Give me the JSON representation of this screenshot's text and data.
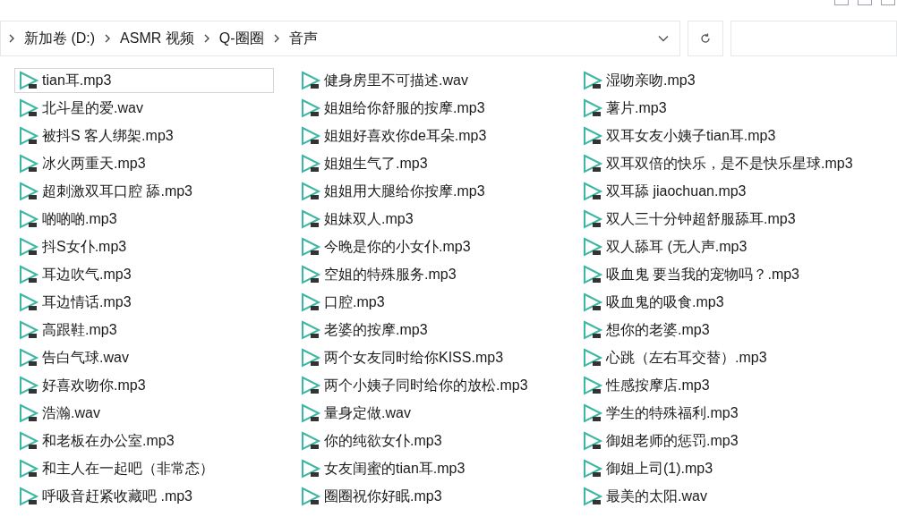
{
  "address_bar": {
    "path": [
      "新加卷 (D:)",
      "ASMR 视频",
      "Q-圈圈",
      "音声"
    ]
  },
  "files": [
    {
      "name": "tian耳.mp3",
      "selected": true
    },
    {
      "name": "北斗星的爱.wav",
      "selected": false
    },
    {
      "name": "被抖S 客人绑架.mp3",
      "selected": false
    },
    {
      "name": "冰火两重天.mp3",
      "selected": false
    },
    {
      "name": "超刺激双耳口腔 舔.mp3",
      "selected": false
    },
    {
      "name": "啲啲啲.mp3",
      "selected": false
    },
    {
      "name": "抖S女仆.mp3",
      "selected": false
    },
    {
      "name": "耳边吹气.mp3",
      "selected": false
    },
    {
      "name": "耳边情话.mp3",
      "selected": false
    },
    {
      "name": "高跟鞋.mp3",
      "selected": false
    },
    {
      "name": "告白气球.wav",
      "selected": false
    },
    {
      "name": "好喜欢吻你.mp3",
      "selected": false
    },
    {
      "name": "浩瀚.wav",
      "selected": false
    },
    {
      "name": "和老板在办公室.mp3",
      "selected": false
    },
    {
      "name": "和主人在一起吧（非常态）",
      "selected": false
    },
    {
      "name": "呼吸音赶紧收藏吧 .mp3",
      "selected": false
    },
    {
      "name": "健身房里不可描述.wav",
      "selected": false
    },
    {
      "name": "姐姐给你舒服的按摩.mp3",
      "selected": false
    },
    {
      "name": "姐姐好喜欢你de耳朵.mp3",
      "selected": false
    },
    {
      "name": "姐姐生气了.mp3",
      "selected": false
    },
    {
      "name": "姐姐用大腿给你按摩.mp3",
      "selected": false
    },
    {
      "name": "姐妹双人.mp3",
      "selected": false
    },
    {
      "name": "今晚是你的小女仆.mp3",
      "selected": false
    },
    {
      "name": "空姐的特殊服务.mp3",
      "selected": false
    },
    {
      "name": "口腔.mp3",
      "selected": false
    },
    {
      "name": "老婆的按摩.mp3",
      "selected": false
    },
    {
      "name": "两个女友同时给你KISS.mp3",
      "selected": false
    },
    {
      "name": "两个小姨子同时给你的放松.mp3",
      "selected": false
    },
    {
      "name": "量身定做.wav",
      "selected": false
    },
    {
      "name": "你的纯欲女仆.mp3",
      "selected": false
    },
    {
      "name": "女友闺蜜的tian耳.mp3",
      "selected": false
    },
    {
      "name": "圈圈祝你好眠.mp3",
      "selected": false
    },
    {
      "name": "湿吻亲吻.mp3",
      "selected": false
    },
    {
      "name": "薯片.mp3",
      "selected": false
    },
    {
      "name": "双耳女友小姨子tian耳.mp3",
      "selected": false
    },
    {
      "name": "双耳双倍的快乐，是不是快乐星球.mp3",
      "selected": false
    },
    {
      "name": "双耳舔 jiaochuan.mp3",
      "selected": false
    },
    {
      "name": "双人三十分钟超舒服舔耳.mp3",
      "selected": false
    },
    {
      "name": "双人舔耳 (无人声.mp3",
      "selected": false
    },
    {
      "name": "吸血鬼 要当我的宠物吗？.mp3",
      "selected": false
    },
    {
      "name": "吸血鬼的吸食.mp3",
      "selected": false
    },
    {
      "name": "想你的老婆.mp3",
      "selected": false
    },
    {
      "name": "心跳（左右耳交替）.mp3",
      "selected": false
    },
    {
      "name": "性感按摩店.mp3",
      "selected": false
    },
    {
      "name": "学生的特殊福利.mp3",
      "selected": false
    },
    {
      "name": "御姐老师的惩罚.mp3",
      "selected": false
    },
    {
      "name": "御姐上司(1).mp3",
      "selected": false
    },
    {
      "name": "最美的太阳.wav",
      "selected": false
    }
  ]
}
